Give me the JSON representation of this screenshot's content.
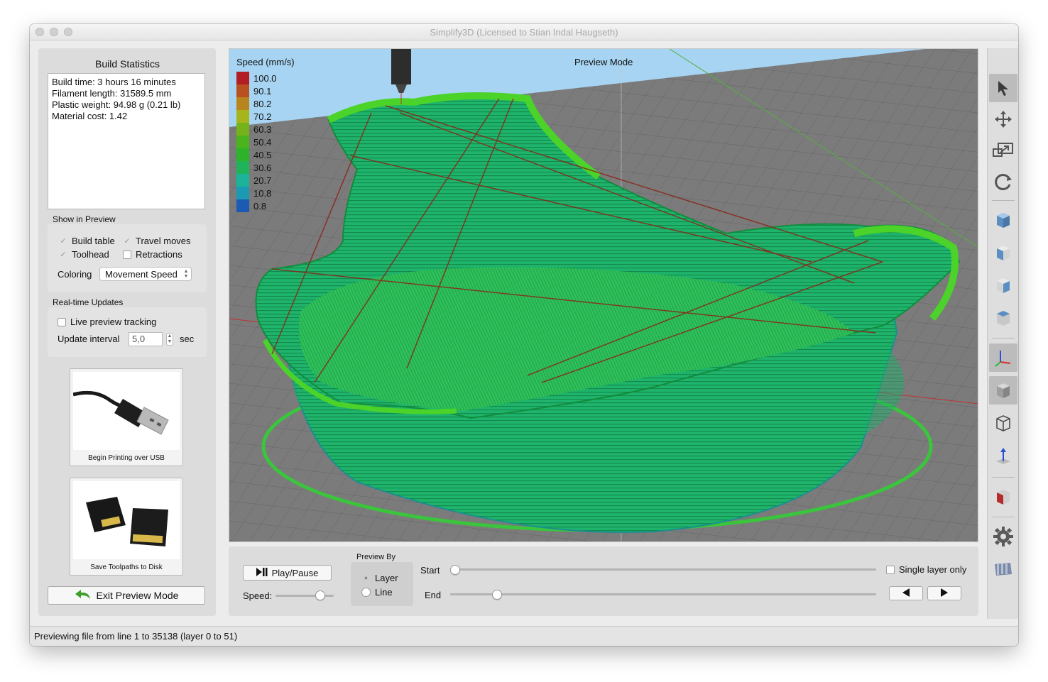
{
  "window": {
    "title": "Simplify3D (Licensed to Stian Indal Haugseth)"
  },
  "left": {
    "build_stats_title": "Build Statistics",
    "stats": [
      "Build time: 3 hours 16 minutes",
      "Filament length: 31589.5 mm",
      "Plastic weight: 94.98 g (0.21 lb)",
      "Material cost: 1.42"
    ],
    "show_in_preview_title": "Show in Preview",
    "build_table": {
      "label": "Build table",
      "checked": true
    },
    "travel_moves": {
      "label": "Travel moves",
      "checked": true
    },
    "toolhead": {
      "label": "Toolhead",
      "checked": true
    },
    "retractions": {
      "label": "Retractions",
      "checked": false
    },
    "coloring_label": "Coloring",
    "coloring_value": "Movement Speed",
    "realtime_title": "Real-time Updates",
    "live_tracking": {
      "label": "Live preview tracking",
      "checked": false
    },
    "update_interval_label": "Update interval",
    "update_interval_value": "5,0",
    "update_interval_unit": "sec",
    "usb_caption": "Begin Printing over USB",
    "sd_caption": "Save Toolpaths to Disk",
    "exit_label": "Exit Preview Mode"
  },
  "viewport": {
    "mode_label": "Preview Mode",
    "legend_title": "Speed (mm/s)",
    "legend": [
      {
        "value": "100.0",
        "color": "#b31e24"
      },
      {
        "value": "90.1",
        "color": "#b8501f"
      },
      {
        "value": "80.2",
        "color": "#b8841d"
      },
      {
        "value": "70.2",
        "color": "#a6b51c"
      },
      {
        "value": "60.3",
        "color": "#76b31b"
      },
      {
        "value": "50.4",
        "color": "#4ab31e"
      },
      {
        "value": "40.5",
        "color": "#2cb32a"
      },
      {
        "value": "30.6",
        "color": "#1fb35a"
      },
      {
        "value": "20.7",
        "color": "#1cb39b"
      },
      {
        "value": "10.8",
        "color": "#1c9ab3"
      },
      {
        "value": "0.8",
        "color": "#1c5ab3"
      }
    ]
  },
  "bottom": {
    "play_label": "Play/Pause",
    "speed_label": "Speed:",
    "speed_fraction": 0.82,
    "preview_by_title": "Preview By",
    "layer_label": "Layer",
    "line_label": "Line",
    "selected_mode": "Layer",
    "start_label": "Start",
    "end_label": "End",
    "start_fraction": 0.0,
    "end_fraction": 0.1,
    "single_layer_label": "Single layer only",
    "prev_icon": "triangle-left-icon",
    "next_icon": "triangle-right-icon"
  },
  "toolbar": {
    "tools": [
      "select-arrow-icon",
      "move-icon",
      "scale-icon",
      "rotate-icon",
      "view-isometric-icon",
      "view-front-icon",
      "view-side-icon",
      "view-top-icon",
      "axes-icon",
      "solid-cube-icon",
      "wireframe-cube-icon",
      "normal-arrow-icon",
      "cross-section-icon",
      "settings-gear-icon",
      "build-table-icon"
    ]
  },
  "status": {
    "text": "Previewing file from line 1 to 35138 (layer 0 to 51)"
  }
}
